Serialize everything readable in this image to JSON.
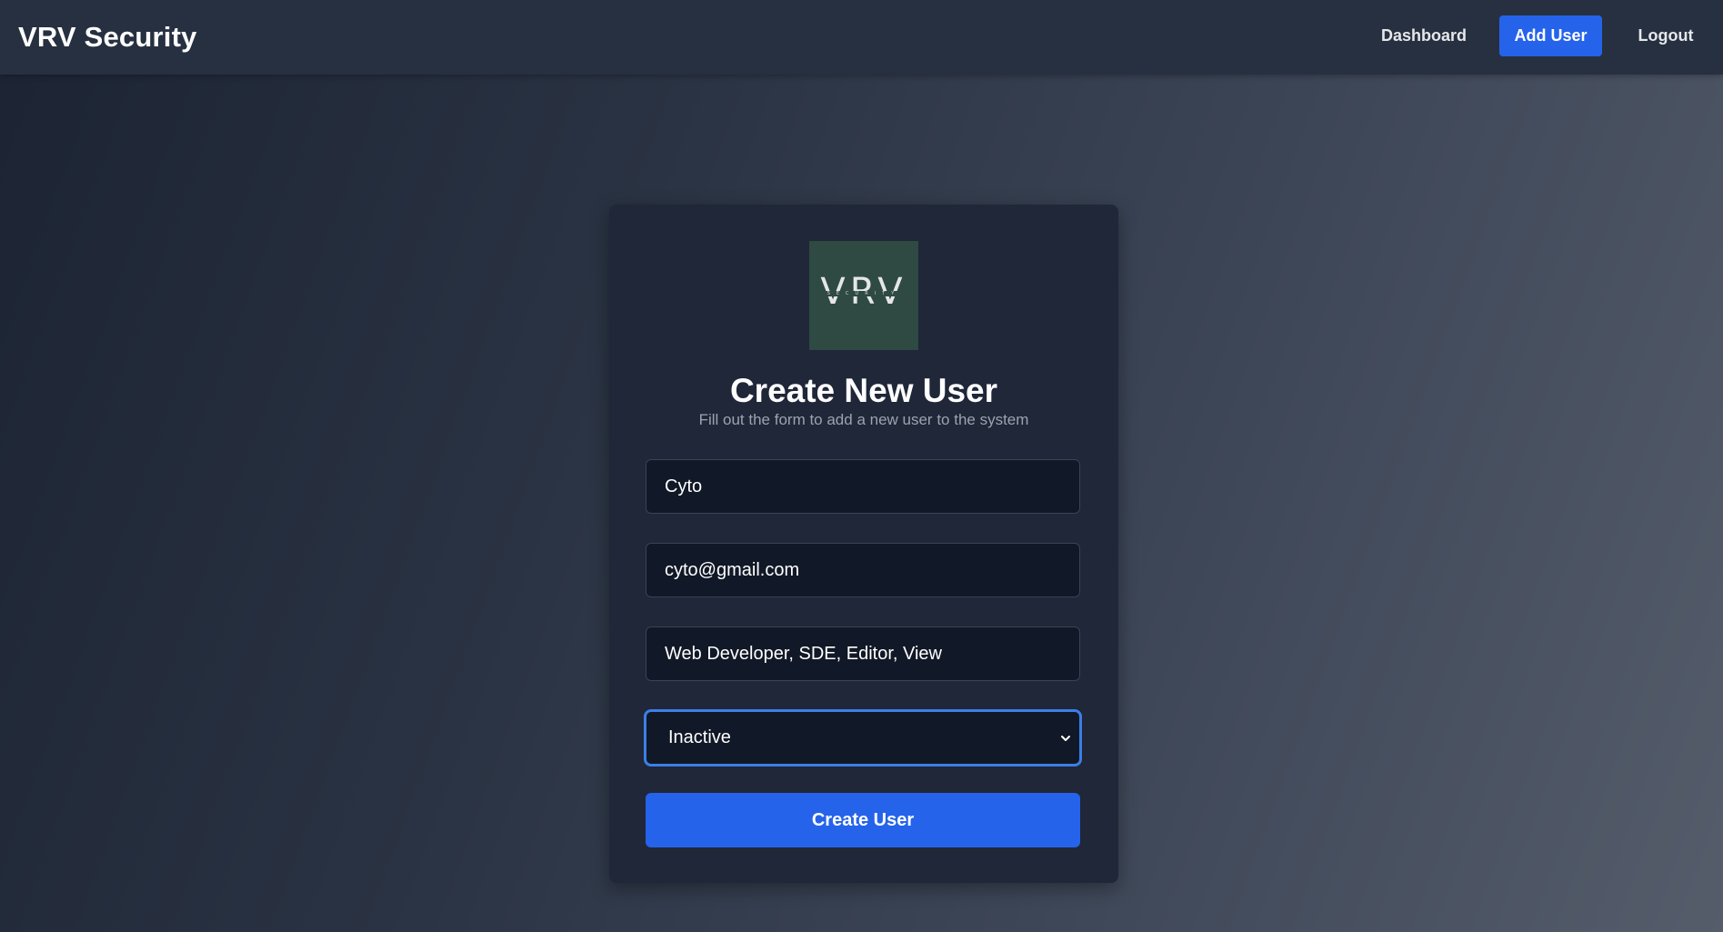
{
  "navbar": {
    "brand": "VRV Security",
    "links": {
      "dashboard": "Dashboard",
      "add_user": "Add User",
      "logout": "Logout"
    },
    "active_color": "#2563eb"
  },
  "form": {
    "logo": {
      "text": "VRV",
      "subtext": "SECURITY"
    },
    "title": "Create New User",
    "subtitle": "Fill out the form to add a new user to the system",
    "fields": {
      "name": "Cyto",
      "email": "cyto@gmail.com",
      "roles": "Web Developer, SDE, Editor, View",
      "status": "Inactive"
    },
    "submit_label": "Create User",
    "icons": {
      "status_dropdown": "chevron-down-icon"
    }
  },
  "colors": {
    "accent": "#2563eb",
    "card_bg": "#1f2738",
    "input_bg": "#111827",
    "focus_border": "#3b7fe6",
    "logo_bg": "#2e4a43"
  }
}
